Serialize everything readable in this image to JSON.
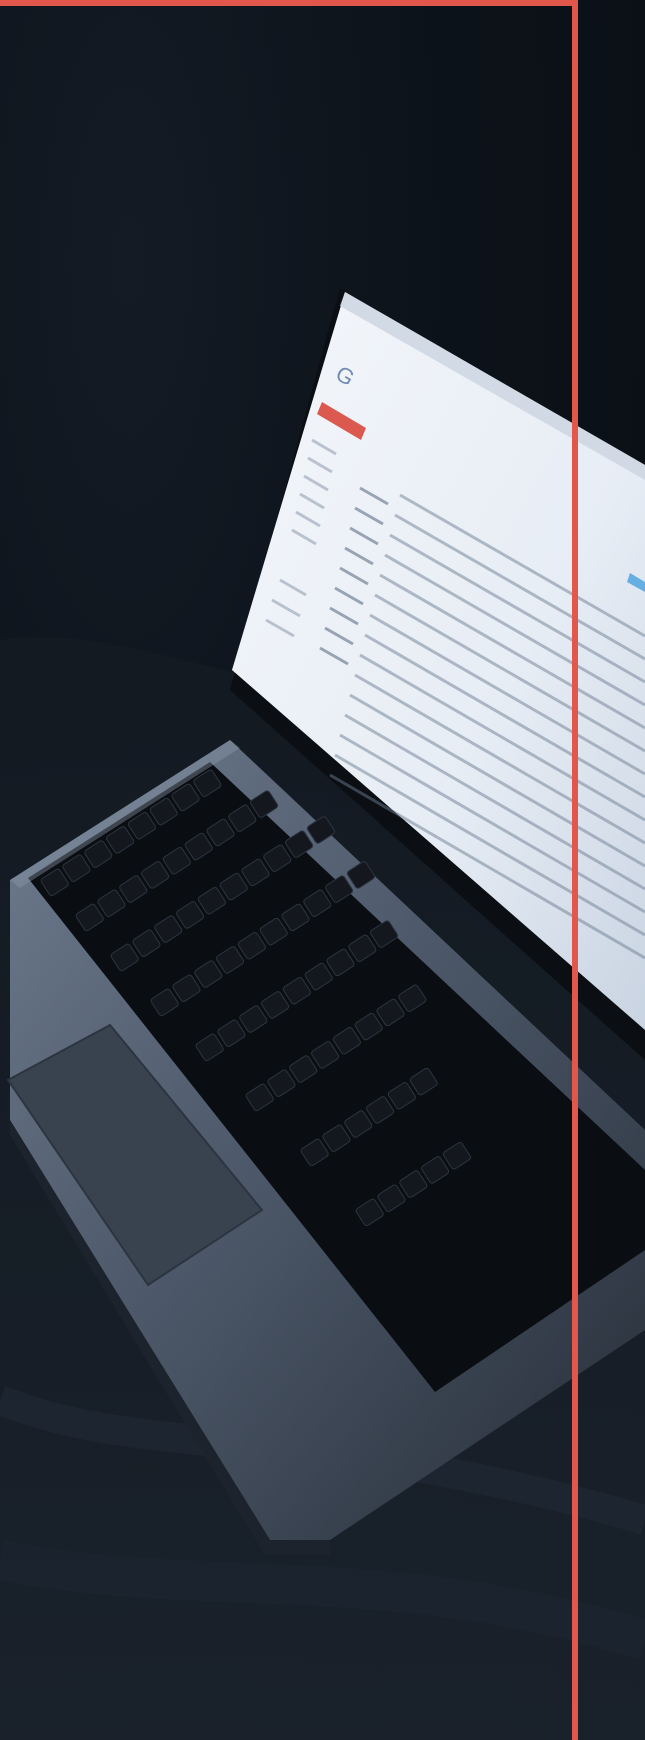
{
  "image": {
    "subject": "laptop-photo",
    "screen_app": "web-email",
    "screen_logo_text": "Google",
    "accent_border_color": "#e2574c",
    "screen_compose_color": "#d9483b",
    "screen_background_color": "#eef2f7",
    "screen_blue_button_color": "#5aa7e0",
    "background_color": "#0c1219",
    "laptop_body_color": "#4f5b6c",
    "keyboard_color": "#0b0e12"
  }
}
